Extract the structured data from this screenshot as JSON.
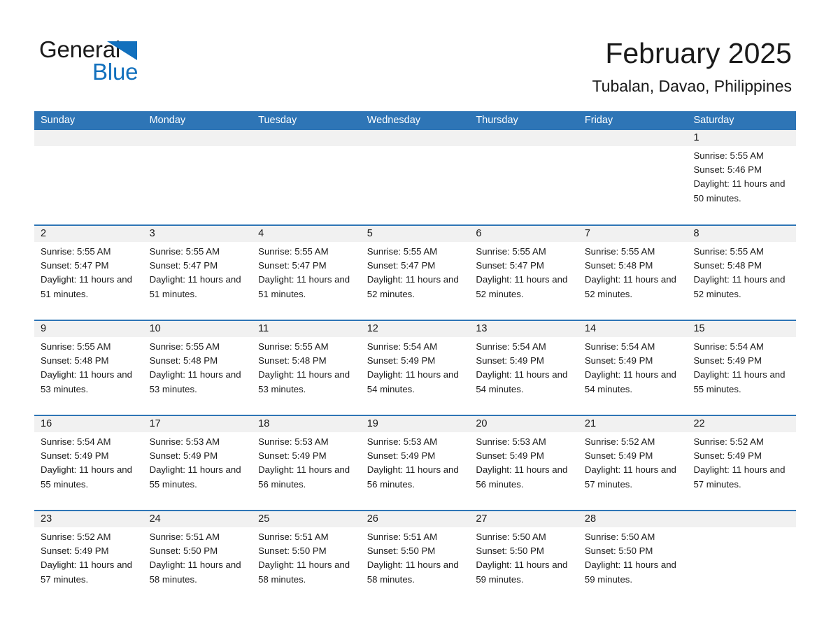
{
  "brand": {
    "logo_text_1": "General",
    "logo_text_2": "Blue",
    "logo_icon": "triangle-icon",
    "accent_color": "#2e75b6",
    "logo_blue": "#1270bd"
  },
  "header": {
    "month_title": "February 2025",
    "location": "Tubalan, Davao, Philippines"
  },
  "calendar": {
    "weekday_headers": [
      "Sunday",
      "Monday",
      "Tuesday",
      "Wednesday",
      "Thursday",
      "Friday",
      "Saturday"
    ],
    "weeks": [
      [
        {
          "day": "",
          "empty": true
        },
        {
          "day": "",
          "empty": true
        },
        {
          "day": "",
          "empty": true
        },
        {
          "day": "",
          "empty": true
        },
        {
          "day": "",
          "empty": true
        },
        {
          "day": "",
          "empty": true
        },
        {
          "day": "1",
          "sunrise": "Sunrise: 5:55 AM",
          "sunset": "Sunset: 5:46 PM",
          "daylight": "Daylight: 11 hours and 50 minutes."
        }
      ],
      [
        {
          "day": "2",
          "sunrise": "Sunrise: 5:55 AM",
          "sunset": "Sunset: 5:47 PM",
          "daylight": "Daylight: 11 hours and 51 minutes."
        },
        {
          "day": "3",
          "sunrise": "Sunrise: 5:55 AM",
          "sunset": "Sunset: 5:47 PM",
          "daylight": "Daylight: 11 hours and 51 minutes."
        },
        {
          "day": "4",
          "sunrise": "Sunrise: 5:55 AM",
          "sunset": "Sunset: 5:47 PM",
          "daylight": "Daylight: 11 hours and 51 minutes."
        },
        {
          "day": "5",
          "sunrise": "Sunrise: 5:55 AM",
          "sunset": "Sunset: 5:47 PM",
          "daylight": "Daylight: 11 hours and 52 minutes."
        },
        {
          "day": "6",
          "sunrise": "Sunrise: 5:55 AM",
          "sunset": "Sunset: 5:47 PM",
          "daylight": "Daylight: 11 hours and 52 minutes."
        },
        {
          "day": "7",
          "sunrise": "Sunrise: 5:55 AM",
          "sunset": "Sunset: 5:48 PM",
          "daylight": "Daylight: 11 hours and 52 minutes."
        },
        {
          "day": "8",
          "sunrise": "Sunrise: 5:55 AM",
          "sunset": "Sunset: 5:48 PM",
          "daylight": "Daylight: 11 hours and 52 minutes."
        }
      ],
      [
        {
          "day": "9",
          "sunrise": "Sunrise: 5:55 AM",
          "sunset": "Sunset: 5:48 PM",
          "daylight": "Daylight: 11 hours and 53 minutes."
        },
        {
          "day": "10",
          "sunrise": "Sunrise: 5:55 AM",
          "sunset": "Sunset: 5:48 PM",
          "daylight": "Daylight: 11 hours and 53 minutes."
        },
        {
          "day": "11",
          "sunrise": "Sunrise: 5:55 AM",
          "sunset": "Sunset: 5:48 PM",
          "daylight": "Daylight: 11 hours and 53 minutes."
        },
        {
          "day": "12",
          "sunrise": "Sunrise: 5:54 AM",
          "sunset": "Sunset: 5:49 PM",
          "daylight": "Daylight: 11 hours and 54 minutes."
        },
        {
          "day": "13",
          "sunrise": "Sunrise: 5:54 AM",
          "sunset": "Sunset: 5:49 PM",
          "daylight": "Daylight: 11 hours and 54 minutes."
        },
        {
          "day": "14",
          "sunrise": "Sunrise: 5:54 AM",
          "sunset": "Sunset: 5:49 PM",
          "daylight": "Daylight: 11 hours and 54 minutes."
        },
        {
          "day": "15",
          "sunrise": "Sunrise: 5:54 AM",
          "sunset": "Sunset: 5:49 PM",
          "daylight": "Daylight: 11 hours and 55 minutes."
        }
      ],
      [
        {
          "day": "16",
          "sunrise": "Sunrise: 5:54 AM",
          "sunset": "Sunset: 5:49 PM",
          "daylight": "Daylight: 11 hours and 55 minutes."
        },
        {
          "day": "17",
          "sunrise": "Sunrise: 5:53 AM",
          "sunset": "Sunset: 5:49 PM",
          "daylight": "Daylight: 11 hours and 55 minutes."
        },
        {
          "day": "18",
          "sunrise": "Sunrise: 5:53 AM",
          "sunset": "Sunset: 5:49 PM",
          "daylight": "Daylight: 11 hours and 56 minutes."
        },
        {
          "day": "19",
          "sunrise": "Sunrise: 5:53 AM",
          "sunset": "Sunset: 5:49 PM",
          "daylight": "Daylight: 11 hours and 56 minutes."
        },
        {
          "day": "20",
          "sunrise": "Sunrise: 5:53 AM",
          "sunset": "Sunset: 5:49 PM",
          "daylight": "Daylight: 11 hours and 56 minutes."
        },
        {
          "day": "21",
          "sunrise": "Sunrise: 5:52 AM",
          "sunset": "Sunset: 5:49 PM",
          "daylight": "Daylight: 11 hours and 57 minutes."
        },
        {
          "day": "22",
          "sunrise": "Sunrise: 5:52 AM",
          "sunset": "Sunset: 5:49 PM",
          "daylight": "Daylight: 11 hours and 57 minutes."
        }
      ],
      [
        {
          "day": "23",
          "sunrise": "Sunrise: 5:52 AM",
          "sunset": "Sunset: 5:49 PM",
          "daylight": "Daylight: 11 hours and 57 minutes."
        },
        {
          "day": "24",
          "sunrise": "Sunrise: 5:51 AM",
          "sunset": "Sunset: 5:50 PM",
          "daylight": "Daylight: 11 hours and 58 minutes."
        },
        {
          "day": "25",
          "sunrise": "Sunrise: 5:51 AM",
          "sunset": "Sunset: 5:50 PM",
          "daylight": "Daylight: 11 hours and 58 minutes."
        },
        {
          "day": "26",
          "sunrise": "Sunrise: 5:51 AM",
          "sunset": "Sunset: 5:50 PM",
          "daylight": "Daylight: 11 hours and 58 minutes."
        },
        {
          "day": "27",
          "sunrise": "Sunrise: 5:50 AM",
          "sunset": "Sunset: 5:50 PM",
          "daylight": "Daylight: 11 hours and 59 minutes."
        },
        {
          "day": "28",
          "sunrise": "Sunrise: 5:50 AM",
          "sunset": "Sunset: 5:50 PM",
          "daylight": "Daylight: 11 hours and 59 minutes."
        },
        {
          "day": "",
          "empty": true
        }
      ]
    ]
  }
}
